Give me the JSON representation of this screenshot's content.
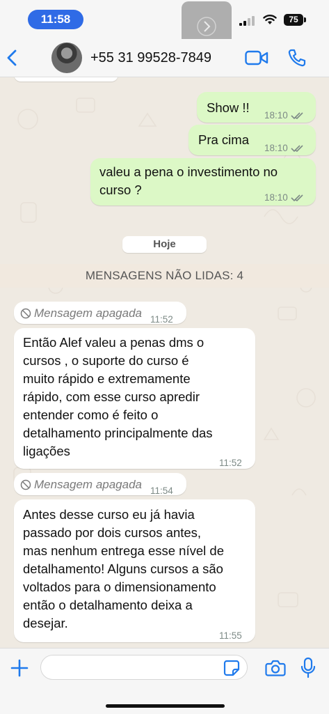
{
  "status_bar": {
    "time": "11:58",
    "battery": "75"
  },
  "header": {
    "contact_name": "+55 31 99528-7849"
  },
  "messages": [
    {
      "direction": "out",
      "text": "Show !!",
      "time": "18:10",
      "status": "read"
    },
    {
      "direction": "out",
      "text": "Pra cima",
      "time": "18:10",
      "status": "read"
    },
    {
      "direction": "out",
      "text": "valeu a pena o investimento no\ncurso ?",
      "time": "18:10",
      "status": "read"
    },
    {
      "direction": "in",
      "deleted": true,
      "text": "Mensagem apagada",
      "time": "11:52"
    },
    {
      "direction": "in",
      "text": "Então Alef valeu a penas dms o\ncursos , o suporte do curso é\nmuito rápido e extremamente\nrápido, com esse curso apredir\nentender como é feito o\ndetalhamento principalmente das\nligações",
      "time": "11:52"
    },
    {
      "direction": "in",
      "deleted": true,
      "text": "Mensagem apagada",
      "time": "11:54"
    },
    {
      "direction": "in",
      "text": "Antes desse curso eu já havia\npassado por dois cursos antes,\nmas nenhum entrega esse nível de\ndetalhamento! Alguns cursos a são\nvoltados para o dimensionamento\nentão o detalhamento deixa a\ndesejar.",
      "time": "11:55"
    }
  ],
  "date_chip": "Hoje",
  "unread_banner": "MENSAGENS NÃO LIDAS: 4",
  "input": {
    "value": "",
    "placeholder": ""
  },
  "colors": {
    "accent": "#1f7aec",
    "outgoing_bubble": "#dcf8c6",
    "incoming_bubble": "#ffffff",
    "time_pill": "#2f6be6"
  },
  "icons": [
    "back-icon",
    "video-call-icon",
    "phone-call-icon",
    "plus-icon",
    "sticker-icon",
    "camera-icon",
    "microphone-icon",
    "deleted-message-icon",
    "read-ticks-icon"
  ]
}
